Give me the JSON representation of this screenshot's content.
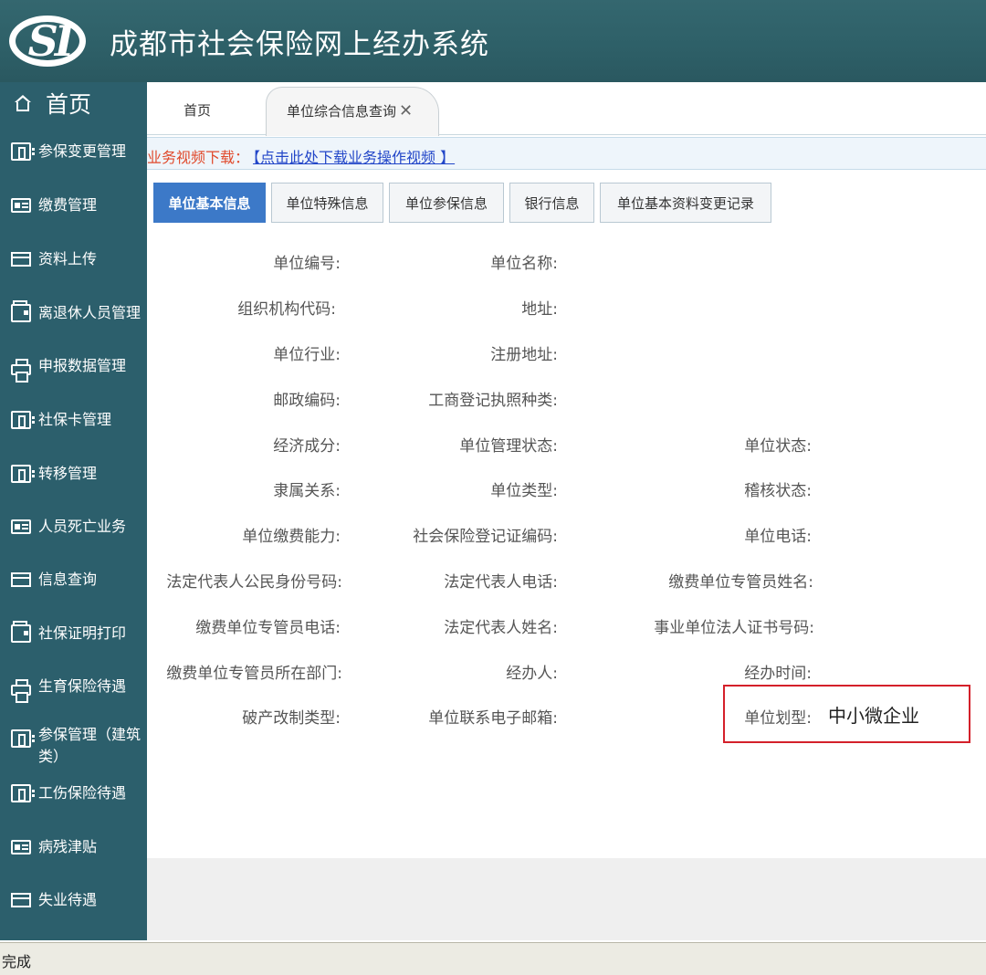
{
  "header": {
    "logo_text": "SI",
    "title": "成都市社会保险网上经办系统"
  },
  "sidebar": {
    "home_label": "首页",
    "items": [
      {
        "label": "参保变更管理",
        "icon": "book-icon"
      },
      {
        "label": "缴费管理",
        "icon": "card-icon"
      },
      {
        "label": "资料上传",
        "icon": "bar-icon"
      },
      {
        "label": "离退休人员管理",
        "icon": "wallet-icon"
      },
      {
        "label": "申报数据管理",
        "icon": "printer-icon"
      },
      {
        "label": "社保卡管理",
        "icon": "book-icon"
      },
      {
        "label": "转移管理",
        "icon": "book-icon"
      },
      {
        "label": "人员死亡业务",
        "icon": "card-icon"
      },
      {
        "label": "信息查询",
        "icon": "bar-icon"
      },
      {
        "label": "社保证明打印",
        "icon": "wallet-icon"
      },
      {
        "label": "生育保险待遇",
        "icon": "printer-icon"
      },
      {
        "label": "参保管理（建筑类）",
        "icon": "book-icon"
      },
      {
        "label": "工伤保险待遇",
        "icon": "book-icon"
      },
      {
        "label": "病残津贴",
        "icon": "card-icon"
      },
      {
        "label": "失业待遇",
        "icon": "bar-icon"
      }
    ]
  },
  "tabs": {
    "home": "首页",
    "active": "单位综合信息查询",
    "close": "✕"
  },
  "notice": {
    "label": "业务视频下载：",
    "link": "【点击此处下载业务操作视频 】"
  },
  "subtabs": [
    "单位基本信息",
    "单位特殊信息",
    "单位参保信息",
    "银行信息",
    "单位基本资料变更记录"
  ],
  "form": {
    "col1": [
      "单位编号:",
      "组织机构代码:",
      "单位行业:",
      "邮政编码:",
      "经济成分:",
      "隶属关系:",
      "单位缴费能力:",
      "法定代表人公民身份号码:",
      "缴费单位专管员电话:",
      "缴费单位专管员所在部门:",
      "破产改制类型:"
    ],
    "col2": [
      "单位名称:",
      "地址:",
      "注册地址:",
      "工商登记执照种类:",
      "单位管理状态:",
      "单位类型:",
      "社会保险登记证编码:",
      "法定代表人电话:",
      "法定代表人姓名:",
      "经办人:",
      "单位联系电子邮箱:"
    ],
    "col3": [
      "单位状态:",
      "稽核状态:",
      "单位电话:",
      "缴费单位专管员姓名:",
      "事业单位法人证书号码:",
      "经办时间:",
      "单位划型:"
    ],
    "unit_type_value": "中小微企业"
  },
  "status": {
    "text": "完成"
  },
  "colors": {
    "header_bg": "#2e6068",
    "sidebar_bg": "#2c5f6c",
    "active_subtab": "#3c79c8",
    "highlight_border": "#d4202a",
    "notice_label": "#e04a2c",
    "notice_link": "#2246c8"
  }
}
